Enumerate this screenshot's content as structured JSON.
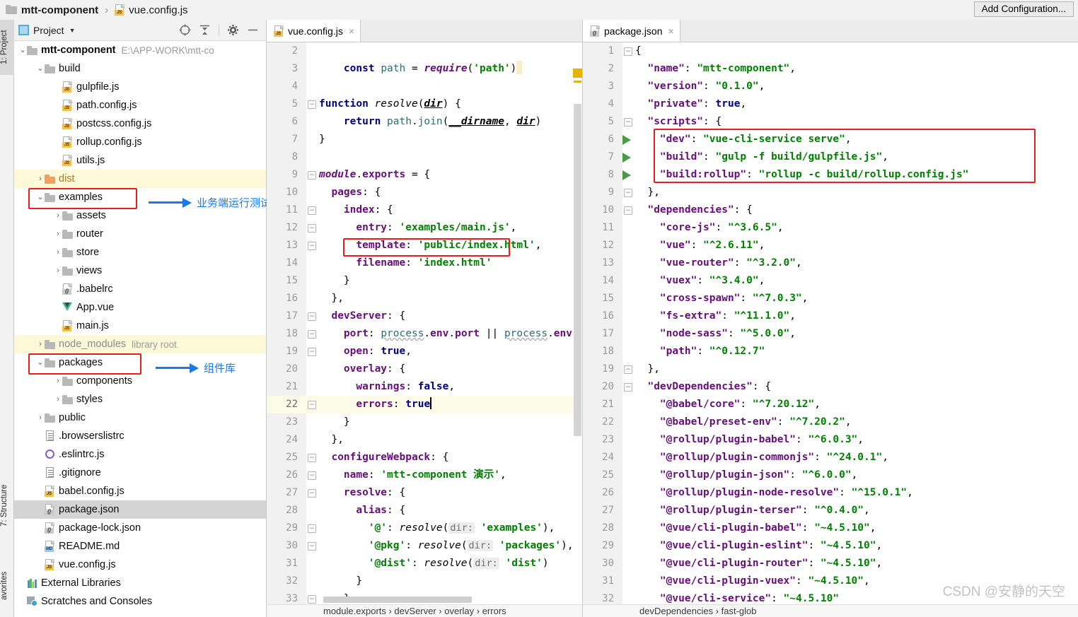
{
  "titlebar": {
    "project_name": "mtt-component",
    "separator": "›",
    "file_name": "vue.config.js",
    "add_configuration_label": "Add Configuration...",
    "folder_icon": "folder-icon",
    "file_icon": "js-file-icon"
  },
  "left_strip": {
    "tabs": [
      {
        "label": "1: Project",
        "active": true
      },
      {
        "label": "7: Structure",
        "active": false
      },
      {
        "label": "avorites",
        "active": false
      }
    ]
  },
  "project_panel": {
    "title": "Project",
    "caret": "▼",
    "tools": [
      {
        "name": "locate-target-icon"
      },
      {
        "name": "collapse-all-icon"
      },
      {
        "name": "settings-gear-icon"
      },
      {
        "name": "hide-panel-icon"
      }
    ],
    "tree": [
      {
        "indent": 0,
        "chev": "⌄",
        "icon": "folder",
        "label": "mtt-component",
        "sub": "E:\\APP-WORK\\mtt-co",
        "bold": true
      },
      {
        "indent": 1,
        "chev": "⌄",
        "icon": "folder",
        "label": "build"
      },
      {
        "indent": 2,
        "chev": "",
        "icon": "js",
        "label": "gulpfile.js"
      },
      {
        "indent": 2,
        "chev": "",
        "icon": "js",
        "label": "path.config.js"
      },
      {
        "indent": 2,
        "chev": "",
        "icon": "js",
        "label": "postcss.config.js"
      },
      {
        "indent": 2,
        "chev": "",
        "icon": "js",
        "label": "rollup.config.js"
      },
      {
        "indent": 2,
        "chev": "",
        "icon": "js",
        "label": "utils.js"
      },
      {
        "indent": 1,
        "chev": "›",
        "icon": "folder-orange",
        "label": "dist",
        "highlight": "yellow",
        "orangeText": true
      },
      {
        "indent": 1,
        "chev": "⌄",
        "icon": "folder",
        "label": "examples"
      },
      {
        "indent": 2,
        "chev": "›",
        "icon": "folder",
        "label": "assets"
      },
      {
        "indent": 2,
        "chev": "›",
        "icon": "folder",
        "label": "router"
      },
      {
        "indent": 2,
        "chev": "›",
        "icon": "folder",
        "label": "store"
      },
      {
        "indent": 2,
        "chev": "›",
        "icon": "folder",
        "label": "views"
      },
      {
        "indent": 2,
        "chev": "",
        "icon": "json",
        "label": ".babelrc"
      },
      {
        "indent": 2,
        "chev": "",
        "icon": "vue",
        "label": "App.vue"
      },
      {
        "indent": 2,
        "chev": "",
        "icon": "js",
        "label": "main.js"
      },
      {
        "indent": 1,
        "chev": "›",
        "icon": "folder",
        "label": "node_modules",
        "sub": "library root",
        "highlight": "yellow",
        "dim": true
      },
      {
        "indent": 1,
        "chev": "⌄",
        "icon": "folder",
        "label": "packages"
      },
      {
        "indent": 2,
        "chev": "›",
        "icon": "folder",
        "label": "components"
      },
      {
        "indent": 2,
        "chev": "›",
        "icon": "folder",
        "label": "styles"
      },
      {
        "indent": 1,
        "chev": "›",
        "icon": "folder",
        "label": "public"
      },
      {
        "indent": 1,
        "chev": "",
        "icon": "txt",
        "label": ".browserslistrc"
      },
      {
        "indent": 1,
        "chev": "",
        "icon": "eslint",
        "label": ".eslintrc.js"
      },
      {
        "indent": 1,
        "chev": "",
        "icon": "txt",
        "label": ".gitignore"
      },
      {
        "indent": 1,
        "chev": "",
        "icon": "js",
        "label": "babel.config.js"
      },
      {
        "indent": 1,
        "chev": "",
        "icon": "json",
        "label": "package.json",
        "highlight": "gray"
      },
      {
        "indent": 1,
        "chev": "",
        "icon": "json",
        "label": "package-lock.json"
      },
      {
        "indent": 1,
        "chev": "",
        "icon": "md",
        "label": "README.md"
      },
      {
        "indent": 1,
        "chev": "",
        "icon": "js",
        "label": "vue.config.js"
      },
      {
        "indent": 0,
        "chev": "",
        "icon": "extlib",
        "label": "External Libraries"
      },
      {
        "indent": 0,
        "chev": "",
        "icon": "scratch",
        "label": "Scratches and Consoles"
      }
    ],
    "annotations": [
      {
        "name": "examples-annotation",
        "text": "业务端运行测试"
      },
      {
        "name": "packages-annotation",
        "text": "组件库"
      }
    ]
  },
  "editor_left": {
    "tab": {
      "label": "vue.config.js",
      "icon": "js-file-icon",
      "close": "×",
      "active": true
    },
    "breadcrumb": "module.exports › devServer › overlay › errors",
    "first_visible_line": 2,
    "current_line": 22,
    "lines": [
      {
        "n": 2,
        "text": ""
      },
      {
        "n": 3,
        "text": "    const path = require('path')"
      },
      {
        "n": 4,
        "text": ""
      },
      {
        "n": 5,
        "text": "function resolve(dir) {"
      },
      {
        "n": 6,
        "text": "    return path.join(__dirname, dir)"
      },
      {
        "n": 7,
        "text": "}"
      },
      {
        "n": 8,
        "text": ""
      },
      {
        "n": 9,
        "text": "module.exports = {"
      },
      {
        "n": 10,
        "text": "  pages: {"
      },
      {
        "n": 11,
        "text": "    index: {"
      },
      {
        "n": 12,
        "text": "      entry: 'examples/main.js',"
      },
      {
        "n": 13,
        "text": "      template: 'public/index.html',"
      },
      {
        "n": 14,
        "text": "      filename: 'index.html'"
      },
      {
        "n": 15,
        "text": "    }"
      },
      {
        "n": 16,
        "text": "  },"
      },
      {
        "n": 17,
        "text": "  devServer: {"
      },
      {
        "n": 18,
        "text": "    port: process.env.port || process.env.npm"
      },
      {
        "n": 19,
        "text": "    open: true,"
      },
      {
        "n": 20,
        "text": "    overlay: {"
      },
      {
        "n": 21,
        "text": "      warnings: false,"
      },
      {
        "n": 22,
        "text": "      errors: true"
      },
      {
        "n": 23,
        "text": "    }"
      },
      {
        "n": 24,
        "text": "  },"
      },
      {
        "n": 25,
        "text": "  configureWebpack: {"
      },
      {
        "n": 26,
        "text": "    name: 'mtt-component 演示',"
      },
      {
        "n": 27,
        "text": "    resolve: {"
      },
      {
        "n": 28,
        "text": "      alias: {"
      },
      {
        "n": 29,
        "text": "        '@': resolve( dir: 'examples'),"
      },
      {
        "n": 30,
        "text": "        '@pkg': resolve( dir: 'packages'),"
      },
      {
        "n": 31,
        "text": "        '@dist': resolve( dir: 'dist')"
      },
      {
        "n": 32,
        "text": "      }"
      },
      {
        "n": 33,
        "text": "    }"
      }
    ],
    "annotation": {
      "name": "entry-line-highlight"
    }
  },
  "editor_right": {
    "tab": {
      "label": "package.json",
      "icon": "json-file-icon",
      "close": "×",
      "active": true
    },
    "breadcrumb": "devDependencies › fast-glob",
    "lines": [
      {
        "n": 1,
        "text": "{"
      },
      {
        "n": 2,
        "text": "  \"name\": \"mtt-component\","
      },
      {
        "n": 3,
        "text": "  \"version\": \"0.1.0\","
      },
      {
        "n": 4,
        "text": "  \"private\": true,"
      },
      {
        "n": 5,
        "text": "  \"scripts\": {"
      },
      {
        "n": 6,
        "text": "    \"dev\": \"vue-cli-service serve\","
      },
      {
        "n": 7,
        "text": "    \"build\": \"gulp -f build/gulpfile.js\","
      },
      {
        "n": 8,
        "text": "    \"build:rollup\": \"rollup -c build/rollup.config.js\""
      },
      {
        "n": 9,
        "text": "  },"
      },
      {
        "n": 10,
        "text": "  \"dependencies\": {"
      },
      {
        "n": 11,
        "text": "    \"core-js\": \"^3.6.5\","
      },
      {
        "n": 12,
        "text": "    \"vue\": \"^2.6.11\","
      },
      {
        "n": 13,
        "text": "    \"vue-router\": \"^3.2.0\","
      },
      {
        "n": 14,
        "text": "    \"vuex\": \"^3.4.0\","
      },
      {
        "n": 15,
        "text": "    \"cross-spawn\": \"^7.0.3\","
      },
      {
        "n": 16,
        "text": "    \"fs-extra\": \"^11.1.0\","
      },
      {
        "n": 17,
        "text": "    \"node-sass\": \"^5.0.0\","
      },
      {
        "n": 18,
        "text": "    \"path\": \"^0.12.7\""
      },
      {
        "n": 19,
        "text": "  },"
      },
      {
        "n": 20,
        "text": "  \"devDependencies\": {"
      },
      {
        "n": 21,
        "text": "    \"@babel/core\": \"^7.20.12\","
      },
      {
        "n": 22,
        "text": "    \"@babel/preset-env\": \"^7.20.2\","
      },
      {
        "n": 23,
        "text": "    \"@rollup/plugin-babel\": \"^6.0.3\","
      },
      {
        "n": 24,
        "text": "    \"@rollup/plugin-commonjs\": \"^24.0.1\","
      },
      {
        "n": 25,
        "text": "    \"@rollup/plugin-json\": \"^6.0.0\","
      },
      {
        "n": 26,
        "text": "    \"@rollup/plugin-node-resolve\": \"^15.0.1\","
      },
      {
        "n": 27,
        "text": "    \"@rollup/plugin-terser\": \"^0.4.0\","
      },
      {
        "n": 28,
        "text": "    \"@vue/cli-plugin-babel\": \"~4.5.10\","
      },
      {
        "n": 29,
        "text": "    \"@vue/cli-plugin-eslint\": \"~4.5.10\","
      },
      {
        "n": 30,
        "text": "    \"@vue/cli-plugin-router\": \"~4.5.10\","
      },
      {
        "n": 31,
        "text": "    \"@vue/cli-plugin-vuex\": \"~4.5.10\","
      },
      {
        "n": 32,
        "text": "    \"@vue/cli-service\": \"~4.5.10\""
      }
    ],
    "run_arrow_lines": [
      6,
      7,
      8
    ],
    "annotation": {
      "name": "scripts-block-highlight"
    }
  },
  "watermark": "CSDN @安静的天空",
  "colors": {
    "accent_red": "#ef1b1b",
    "accent_blue": "#1b78e8",
    "string_green": "#008000",
    "keyword_navy": "#000080",
    "property_purple": "#660e7a",
    "highlight_yellow": "#fdf8d8",
    "selection_gray": "#d4d4d4"
  }
}
